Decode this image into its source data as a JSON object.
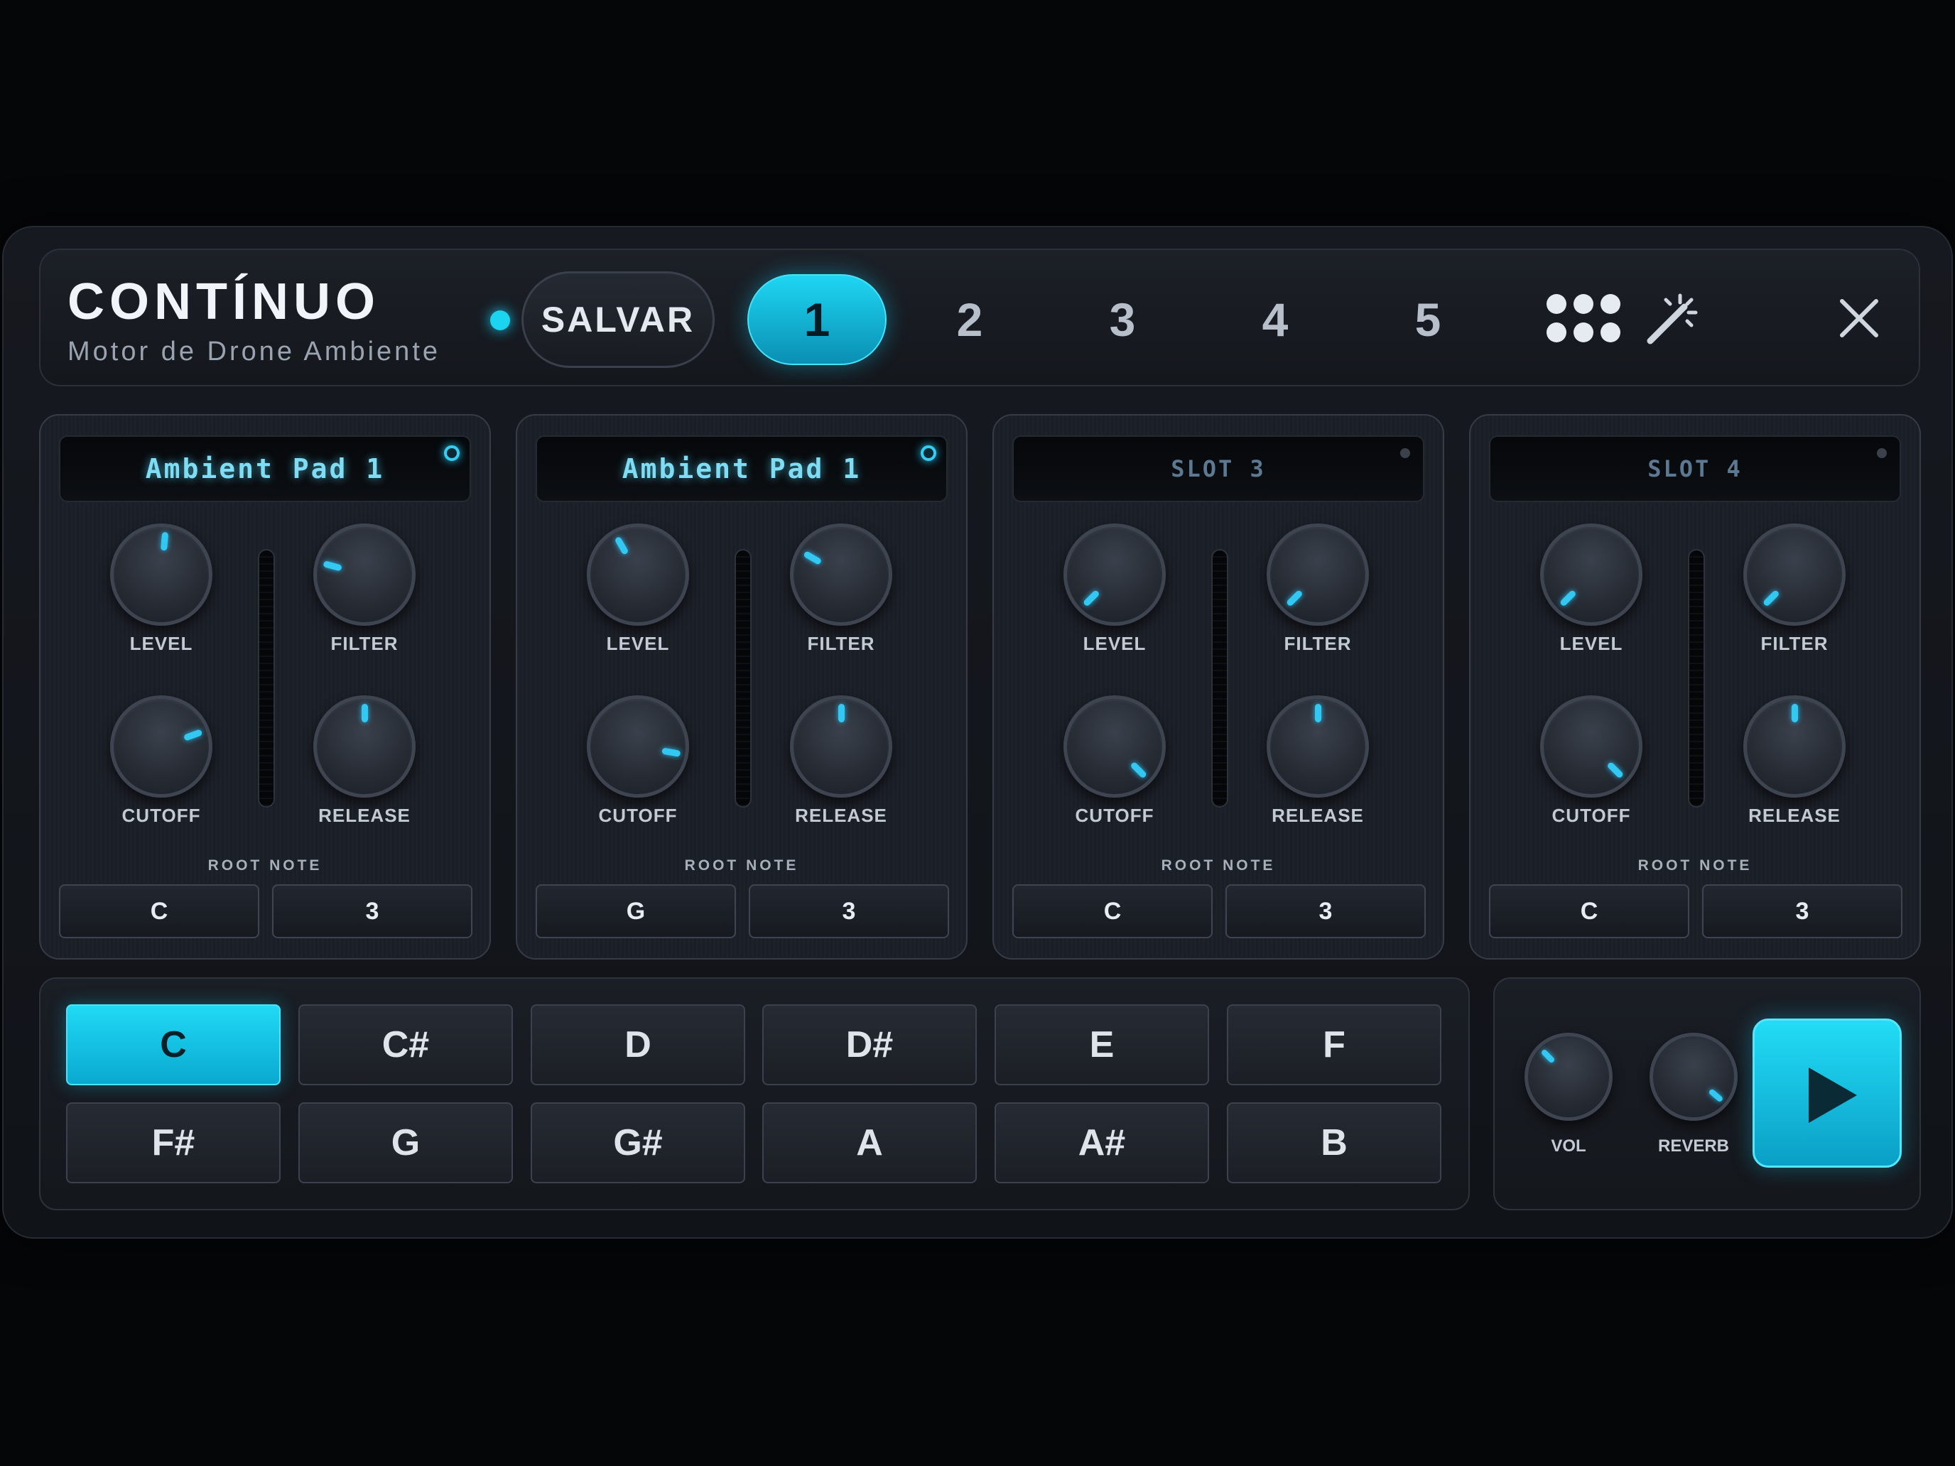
{
  "header": {
    "title": "CONTÍNUO",
    "subtitle": "Motor de Drone Ambiente",
    "save_label": "SALVAR",
    "presets": [
      {
        "label": "1",
        "active": true
      },
      {
        "label": "2",
        "active": false
      },
      {
        "label": "3",
        "active": false
      },
      {
        "label": "4",
        "active": false
      },
      {
        "label": "5",
        "active": false
      }
    ],
    "icons": [
      "status-dot",
      "grid-icon",
      "magic-wand-icon",
      "close-icon"
    ]
  },
  "accent_color": "#1cd3f0",
  "slots": [
    {
      "name": "Ambient Pad 1",
      "active": true,
      "knob_labels": [
        "LEVEL",
        "FILTER",
        "CUTOFF",
        "RELEASE"
      ],
      "knob_angles": [
        5,
        -75,
        70,
        0
      ],
      "root_label": "ROOT NOTE",
      "root_note": "C",
      "octave": "3"
    },
    {
      "name": "Ambient Pad 1",
      "active": true,
      "knob_labels": [
        "LEVEL",
        "FILTER",
        "CUTOFF",
        "RELEASE"
      ],
      "knob_angles": [
        -30,
        -60,
        100,
        0
      ],
      "root_label": "ROOT NOTE",
      "root_note": "G",
      "octave": "3"
    },
    {
      "name": "SLOT 3",
      "active": false,
      "knob_labels": [
        "LEVEL",
        "FILTER",
        "CUTOFF",
        "RELEASE"
      ],
      "knob_angles": [
        -135,
        -135,
        135,
        0
      ],
      "root_label": "ROOT NOTE",
      "root_note": "C",
      "octave": "3"
    },
    {
      "name": "SLOT 4",
      "active": false,
      "knob_labels": [
        "LEVEL",
        "FILTER",
        "CUTOFF",
        "RELEASE"
      ],
      "knob_angles": [
        -135,
        -135,
        135,
        0
      ],
      "root_label": "ROOT NOTE",
      "root_note": "C",
      "octave": "3"
    }
  ],
  "keys": [
    "C",
    "C#",
    "D",
    "D#",
    "E",
    "F",
    "F#",
    "G",
    "G#",
    "A",
    "A#",
    "B"
  ],
  "active_key": "C",
  "output": {
    "vol_label": "VOL",
    "vol_angle": -45,
    "reverb_label": "REVERB",
    "reverb_angle": 130,
    "play_icon": "play-icon"
  }
}
